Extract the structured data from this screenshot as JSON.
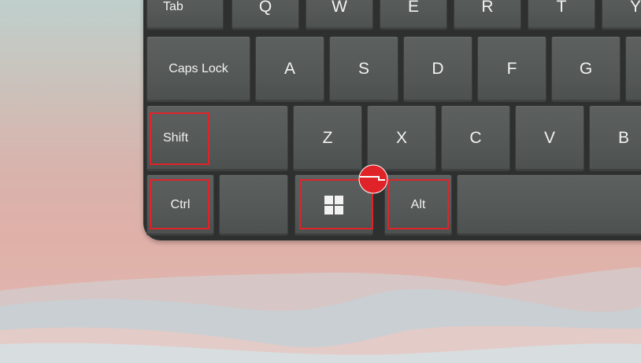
{
  "keyboard": {
    "row_top": [
      "Tab",
      "Q",
      "W",
      "E",
      "R",
      "T",
      "Y"
    ],
    "row_home": [
      "Caps Lock",
      "A",
      "S",
      "D",
      "F",
      "G"
    ],
    "row_shift": [
      "Shift",
      "Z",
      "X",
      "C",
      "V",
      "B"
    ],
    "row_bottom": {
      "ctrl": "Ctrl",
      "windows": "windows-logo-icon",
      "alt": "Alt"
    }
  },
  "highlight_color": "#e02329"
}
